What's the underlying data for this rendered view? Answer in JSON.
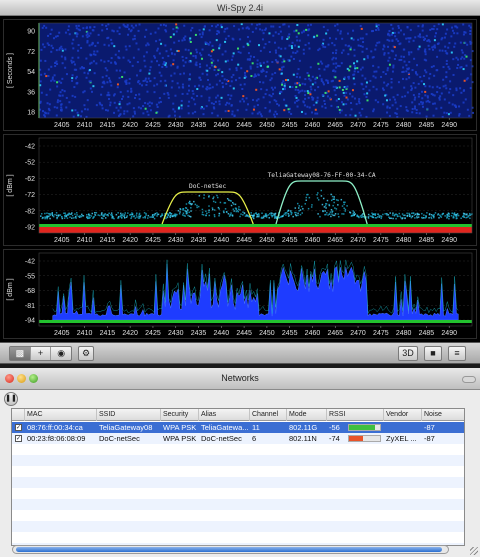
{
  "app": {
    "title": "Wi-Spy 2.4i"
  },
  "colors": {
    "waterfall_bg": "#0a1a6e",
    "plot_bg": "#000000",
    "grid": "#2a2a2a",
    "axis_label": "#e0e0e0",
    "topo_fill": "#1e3cff",
    "max_line": "#19c8d8",
    "floor_green": "#22c22e",
    "floor_red": "#e0261e",
    "network_curve": "#e8f04a",
    "network_curve_2": "#8ef0c8",
    "selection": "#3b6ed3"
  },
  "x_ticks": [
    "2405",
    "2410",
    "2415",
    "2420",
    "2425",
    "2430",
    "2435",
    "2440",
    "2445",
    "2450",
    "2455",
    "2460",
    "2465",
    "2470",
    "2475",
    "2480",
    "2485",
    "2490"
  ],
  "waterfall": {
    "ylabel": "[ Seconds ]",
    "y_ticks": [
      "90",
      "72",
      "54",
      "36",
      "18"
    ]
  },
  "density": {
    "ylabel": "[ dBm ]",
    "y_ticks": [
      "-42",
      "-52",
      "-62",
      "-72",
      "-82",
      "-92"
    ],
    "networks": [
      {
        "label": "DoC-netSec"
      },
      {
        "label": "TeliaGateway08-76-FF-00-34-CA"
      }
    ]
  },
  "topo": {
    "ylabel": "[ dBm ]",
    "y_ticks": [
      "-42",
      "-55",
      "-68",
      "-81",
      "-94"
    ]
  },
  "toolbar": {
    "view_icon": "monitor-icon",
    "add_label": "+",
    "eye_icon": "eye-icon",
    "gear_icon": "gear-icon",
    "btn_3d": "3D",
    "disk_icon": "disk-icon",
    "list_icon": "list-icon"
  },
  "networks_window": {
    "title": "Networks",
    "pause_icon": "pause-icon",
    "columns": [
      "MAC",
      "SSID",
      "Security",
      "Alias",
      "Channel",
      "Mode",
      "RSSI",
      "Vendor",
      "Noise"
    ],
    "rows": [
      {
        "checked": true,
        "mac": "08:76:ff:00:34:ca",
        "ssid": "TeliaGateway08",
        "security": "WPA PSK",
        "alias": "TeliaGatewa...",
        "channel": "11",
        "mode": "802.11G",
        "rssi": "-56",
        "rssi_level": 0.85,
        "rssi_color": "#3fbf3f",
        "vendor": "",
        "noise": "-87",
        "selected": true
      },
      {
        "checked": true,
        "mac": "00:23:f8:06:08:09",
        "ssid": "DoC-netSec",
        "security": "WPA PSK",
        "alias": "DoC-netSec",
        "channel": "6",
        "mode": "802.11N",
        "rssi": "-74",
        "rssi_level": 0.45,
        "rssi_color": "#e8532a",
        "vendor": "ZyXEL ...",
        "noise": "-87",
        "selected": false
      }
    ]
  }
}
